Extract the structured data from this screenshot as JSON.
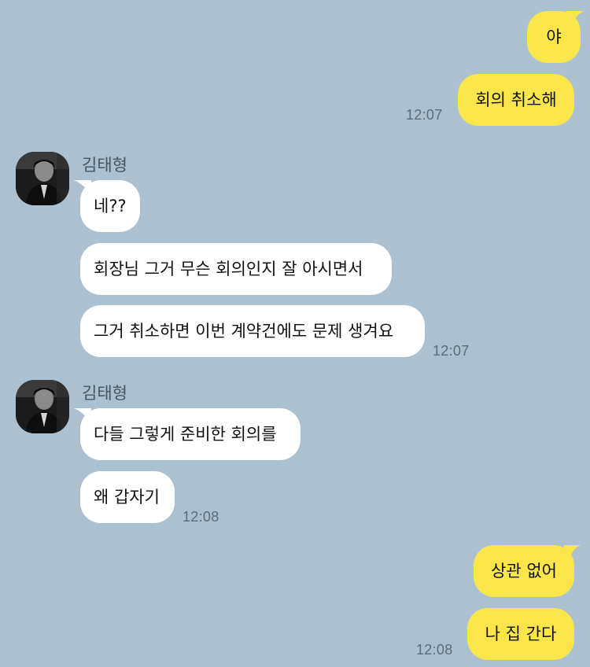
{
  "colors": {
    "background": "#abc1d1",
    "my_bubble": "#fae64b",
    "their_bubble": "#ffffff",
    "time_text": "#5f6b75"
  },
  "messages": {
    "m1": "야",
    "m2": "회의 취소해",
    "t1": "12:07",
    "sender1": "김태형",
    "m3": "네??",
    "m4": "회장님 그거 무슨 회의인지 잘 아시면서",
    "m5": "그거 취소하면 이번 계약건에도 문제 생겨요",
    "t2": "12:07",
    "sender2": "김태형",
    "m6": "다들 그렇게 준비한 회의를",
    "m7": "왜 갑자기",
    "t3": "12:08",
    "m8": "상관 없어",
    "m9": "나 집 간다",
    "t4": "12:08"
  },
  "icons": {
    "avatar": "avatar-photo-icon"
  }
}
